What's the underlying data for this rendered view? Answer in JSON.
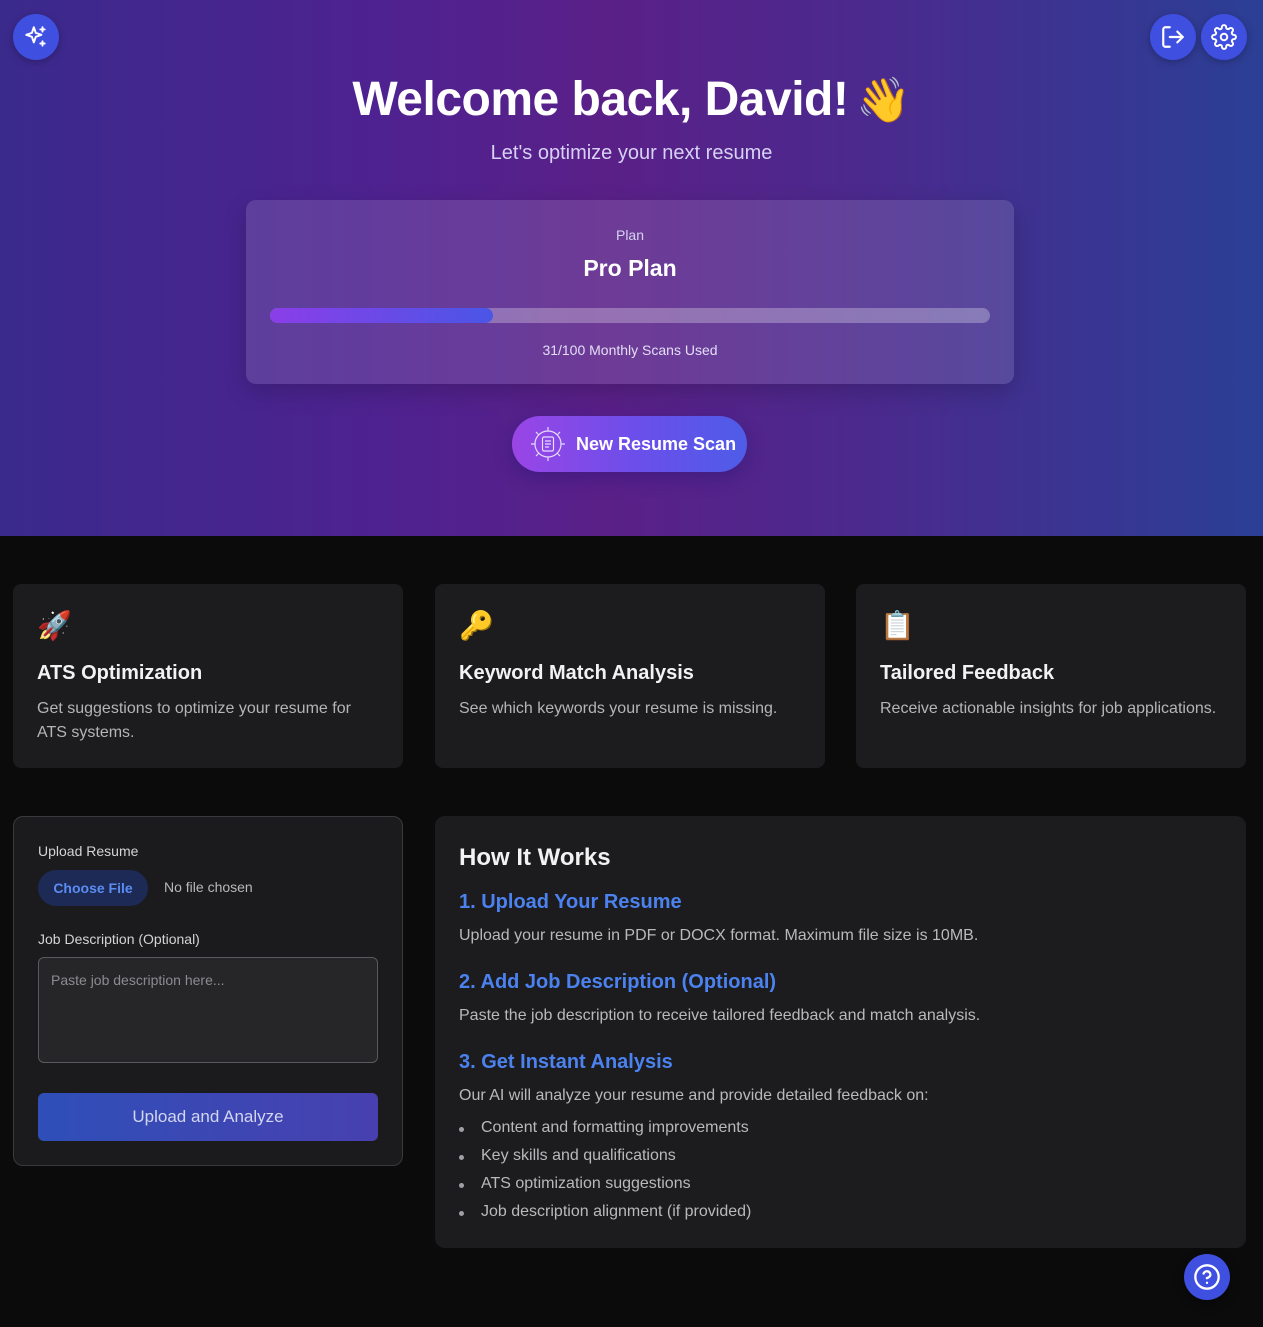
{
  "header": {
    "logo_icon": "sparkles-icon",
    "logout_icon": "log-out-icon",
    "settings_icon": "gear-icon",
    "welcome": "Welcome back, David!",
    "wave_emoji": "👋",
    "subtitle": "Let's optimize your next resume",
    "accent_color": "#3f4fe0"
  },
  "plan": {
    "label": "Plan",
    "name": "Pro Plan",
    "scans_used": 31,
    "scans_total": 100,
    "usage_text": "31/100 Monthly Scans Used"
  },
  "scan_button": {
    "label": "New Resume Scan",
    "icon": "gear-document-icon"
  },
  "features": [
    {
      "emoji": "🚀",
      "icon": "rocket-icon",
      "title": "ATS Optimization",
      "description": "Get suggestions to optimize your resume for ATS systems."
    },
    {
      "emoji": "🔑",
      "icon": "key-icon",
      "title": "Keyword Match Analysis",
      "description": "See which keywords your resume is missing."
    },
    {
      "emoji": "📋",
      "icon": "clipboard-icon",
      "title": "Tailored Feedback",
      "description": "Receive actionable insights for job applications."
    }
  ],
  "upload": {
    "resume_label": "Upload Resume",
    "choose_file": "Choose File",
    "no_file": "No file chosen",
    "jd_label": "Job Description (Optional)",
    "jd_placeholder": "Paste job description here...",
    "submit": "Upload and Analyze"
  },
  "how_it_works": {
    "title": "How It Works",
    "steps": [
      {
        "title": "1. Upload Your Resume",
        "description": "Upload your resume in PDF or DOCX format. Maximum file size is 10MB."
      },
      {
        "title": "2. Add Job Description (Optional)",
        "description": "Paste the job description to receive tailored feedback and match analysis."
      },
      {
        "title": "3. Get Instant Analysis",
        "description": "Our AI will analyze your resume and provide detailed feedback on:"
      }
    ],
    "bullets": [
      "Content and formatting improvements",
      "Key skills and qualifications",
      "ATS optimization suggestions",
      "Job description alignment (if provided)"
    ]
  },
  "help_icon": "help-circle-icon"
}
